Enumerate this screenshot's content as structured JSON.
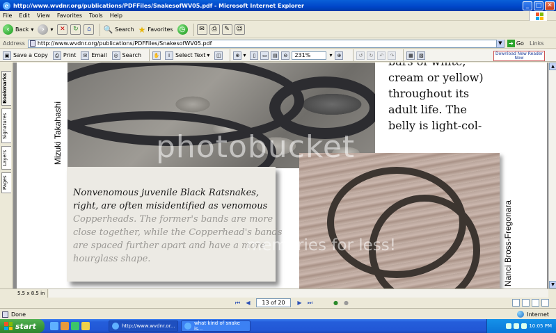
{
  "window": {
    "title": "http://www.wvdnr.org/publications/PDFFiles/SnakesofWV05.pdf - Microsoft Internet Explorer",
    "minimize": "_",
    "maximize": "□",
    "close": "✕"
  },
  "menu": {
    "items": [
      "File",
      "Edit",
      "View",
      "Favorites",
      "Tools",
      "Help"
    ]
  },
  "toolbar": {
    "back_label": "Back",
    "search_label": "Search",
    "favorites_label": "Favorites"
  },
  "address": {
    "label": "Address",
    "url": "http://www.wvdnr.org/publications/PDFFiles/SnakesofWV05.pdf",
    "go_label": "Go",
    "links_label": "Links"
  },
  "reader": {
    "save_copy_label": "Save a Copy",
    "print_label": "Print",
    "email_label": "Email",
    "search_label": "Search",
    "select_text_label": "Select Text",
    "zoom_value": "231%",
    "download_label_1": "Download New Reader",
    "download_label_2": "Now"
  },
  "nav_tabs": {
    "bookmarks": "Bookmarks",
    "signatures": "Signatures",
    "layers": "Layers",
    "pages": "Pages"
  },
  "document": {
    "photo1_credit": "Mizuki Takahashi",
    "photo2_credit": "Nanci Bross-Fregonara",
    "caption_lines": [
      "Nonvenomous juvenile Black Ratsnakes,",
      "right,  are often misidentified as venomous",
      "Copperheads. The former's  bands are more",
      "close together, while the Copperhead's bands",
      "are spaced further apart and have a more",
      "hourglass shape."
    ],
    "body_lines": [
      "bars of white,",
      "cream or yellow)",
      "throughout its",
      "adult life.  The",
      "belly is light-col-"
    ]
  },
  "watermark": {
    "main": "photobucket",
    "sub": "memories for less!"
  },
  "status": {
    "page_size": "5.5 x 8.5 in",
    "page_indicator": "13 of 20",
    "done_label": "Done",
    "zone_label": "Internet"
  },
  "taskbar": {
    "start_label": "start",
    "task1_label": "http://www.wvdnr.or...",
    "task2_label": "what kind of snake is...",
    "time": "10:05 PM"
  }
}
